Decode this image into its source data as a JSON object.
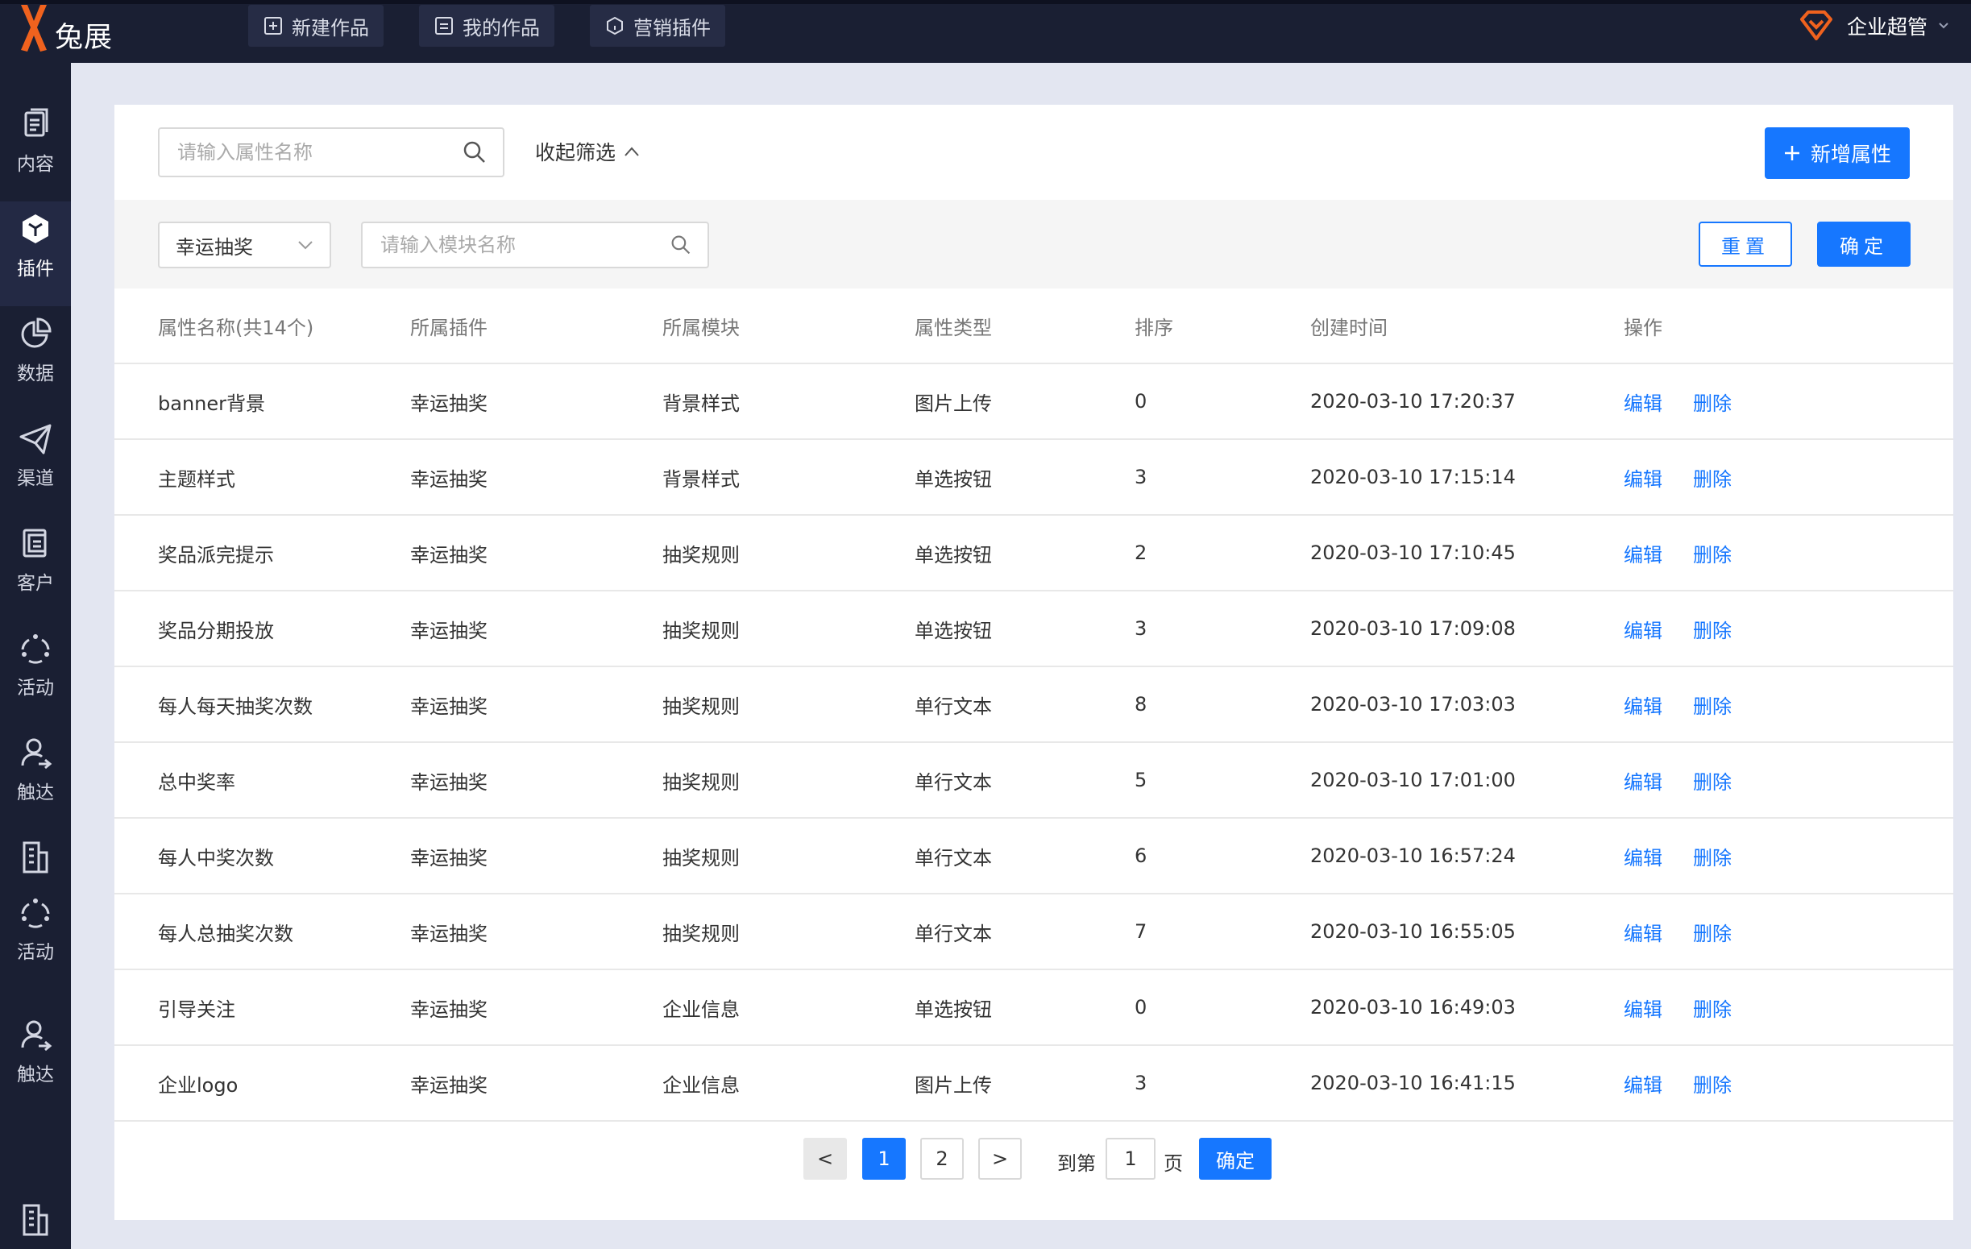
{
  "app": {
    "name": "兔展",
    "brand_color": "#f0621e",
    "accent_color": "#1677ff"
  },
  "topnav": [
    {
      "label": "新建作品",
      "icon": "plus-square-icon"
    },
    {
      "label": "我的作品",
      "icon": "doc-icon"
    },
    {
      "label": "营销插件",
      "icon": "hexagon-icon"
    }
  ],
  "user": {
    "name": "企业超管",
    "icon": "diamond-icon"
  },
  "sidebar": {
    "items": [
      {
        "label": "内容",
        "icon": "content-icon"
      },
      {
        "label": "插件",
        "icon": "plugin-icon",
        "active": true
      },
      {
        "label": "数据",
        "icon": "pie-chart-icon"
      },
      {
        "label": "渠道",
        "icon": "paper-plane-icon"
      },
      {
        "label": "客户",
        "icon": "customer-icon"
      },
      {
        "label": "活动",
        "icon": "activity-icon"
      },
      {
        "label": "触达",
        "icon": "reach-icon"
      },
      {
        "label": "",
        "icon": "building-icon"
      },
      {
        "label": "活动",
        "icon": "activity-icon"
      },
      {
        "label": "触达",
        "icon": "reach-icon"
      },
      {
        "label": "",
        "icon": "building-icon"
      }
    ]
  },
  "toolbar": {
    "search_placeholder": "请输入属性名称",
    "collapse_label": "收起筛选",
    "add_label": "新增属性"
  },
  "filter": {
    "plugin_selected": "幸运抽奖",
    "module_placeholder": "请输入模块名称",
    "reset_label": "重置",
    "confirm_label": "确定"
  },
  "table": {
    "columns": [
      "属性名称(共14个)",
      "所属插件",
      "所属模块",
      "属性类型",
      "排序",
      "创建时间",
      "操作"
    ],
    "actions": {
      "edit": "编辑",
      "delete": "删除"
    },
    "rows": [
      {
        "name": "banner背景",
        "plugin": "幸运抽奖",
        "module": "背景样式",
        "type": "图片上传",
        "order": "0",
        "created": "2020-03-10 17:20:37"
      },
      {
        "name": "主题样式",
        "plugin": "幸运抽奖",
        "module": "背景样式",
        "type": "单选按钮",
        "order": "3",
        "created": "2020-03-10 17:15:14"
      },
      {
        "name": "奖品派完提示",
        "plugin": "幸运抽奖",
        "module": "抽奖规则",
        "type": "单选按钮",
        "order": "2",
        "created": "2020-03-10 17:10:45"
      },
      {
        "name": "奖品分期投放",
        "plugin": "幸运抽奖",
        "module": "抽奖规则",
        "type": "单选按钮",
        "order": "3",
        "created": "2020-03-10 17:09:08"
      },
      {
        "name": "每人每天抽奖次数",
        "plugin": "幸运抽奖",
        "module": "抽奖规则",
        "type": "单行文本",
        "order": "8",
        "created": "2020-03-10 17:03:03"
      },
      {
        "name": "总中奖率",
        "plugin": "幸运抽奖",
        "module": "抽奖规则",
        "type": "单行文本",
        "order": "5",
        "created": "2020-03-10 17:01:00"
      },
      {
        "name": "每人中奖次数",
        "plugin": "幸运抽奖",
        "module": "抽奖规则",
        "type": "单行文本",
        "order": "6",
        "created": "2020-03-10 16:57:24"
      },
      {
        "name": "每人总抽奖次数",
        "plugin": "幸运抽奖",
        "module": "抽奖规则",
        "type": "单行文本",
        "order": "7",
        "created": "2020-03-10 16:55:05"
      },
      {
        "name": "引导关注",
        "plugin": "幸运抽奖",
        "module": "企业信息",
        "type": "单选按钮",
        "order": "0",
        "created": "2020-03-10 16:49:03"
      },
      {
        "name": "企业logo",
        "plugin": "幸运抽奖",
        "module": "企业信息",
        "type": "图片上传",
        "order": "3",
        "created": "2020-03-10 16:41:15"
      }
    ]
  },
  "pagination": {
    "prev": "<",
    "pages": [
      "1",
      "2"
    ],
    "current": "1",
    "next": ">",
    "goto_label": "到第",
    "goto_value": "1",
    "page_unit": "页",
    "confirm": "确定"
  }
}
